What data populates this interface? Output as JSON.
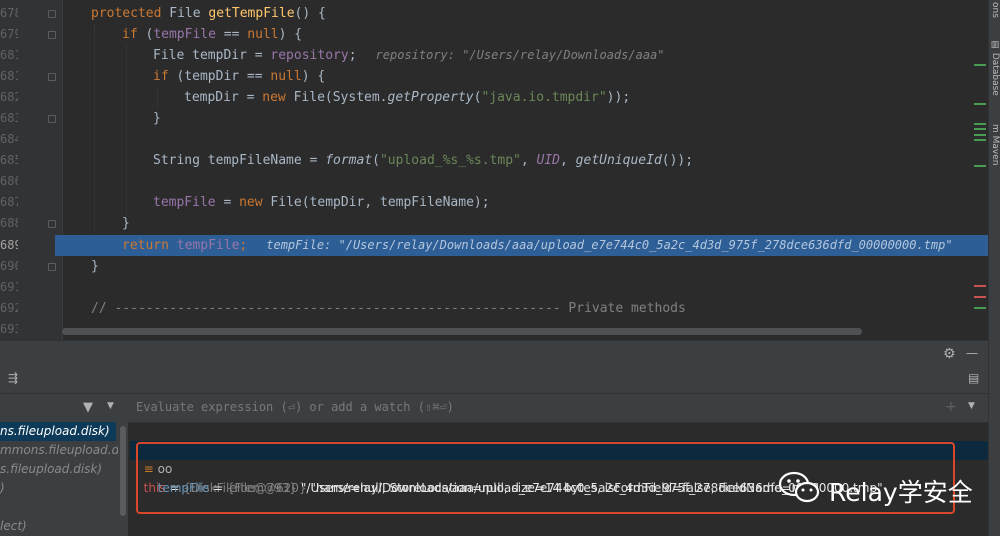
{
  "editor": {
    "lines": [
      {
        "num": "678"
      },
      {
        "num": "679"
      },
      {
        "num": "681"
      },
      {
        "num": "681"
      },
      {
        "num": "682"
      },
      {
        "num": "683"
      },
      {
        "num": "684"
      },
      {
        "num": "685"
      },
      {
        "num": "686"
      },
      {
        "num": "687"
      },
      {
        "num": "688"
      },
      {
        "num": "689"
      },
      {
        "num": "690"
      },
      {
        "num": "691"
      },
      {
        "num": "692"
      },
      {
        "num": "693"
      }
    ],
    "code": {
      "l1_kw": "protected",
      "l1_type": " File ",
      "l1_fn": "getTempFile",
      "l1_rest": "() {",
      "l2_kw": "if",
      "l2_a": " (",
      "l2_fld": "tempFile",
      "l2_b": " == ",
      "l2_kw2": "null",
      "l2_c": ") {",
      "l3_a": "File tempDir = ",
      "l3_fld": "repository",
      "l3_b": ";",
      "l3_hint": "repository: \"/Users/relay/Downloads/aaa\"",
      "l4_kw": "if",
      "l4_a": " (tempDir == ",
      "l4_kw2": "null",
      "l4_b": ") {",
      "l5_a": "tempDir = ",
      "l5_kw": "new",
      "l5_b": " File(System.",
      "l5_fn": "getProperty",
      "l5_c": "(",
      "l5_str": "\"java.io.tmpdir\"",
      "l5_d": "));",
      "l6": "}",
      "l8_a": "String tempFileName = ",
      "l8_fn": "format",
      "l8_b": "(",
      "l8_str": "\"upload_%s_%s.tmp\"",
      "l8_c": ", ",
      "l8_fld": "UID",
      "l8_d": ", ",
      "l8_fn2": "getUniqueId",
      "l8_e": "());",
      "l10_fld": "tempFile",
      "l10_a": " = ",
      "l10_kw": "new",
      "l10_b": " File(tempDir, tempFileName);",
      "l11": "}",
      "l12_kw": "return",
      "l12_fld": " tempFile",
      "l12_a": ";",
      "l12_hint": "tempFile: \"/Users/relay/Downloads/aaa/upload_e7e744c0_5a2c_4d3d_975f_278dce636dfd_00000000.tmp\"",
      "l13": "}",
      "l15": "// --------------------------------------------------------- Private methods"
    }
  },
  "right_strip": {
    "tabs": [
      "ons",
      "Database",
      "Maven"
    ]
  },
  "debug": {
    "eval_placeholder": "Evaluate expression (⏎) or add a watch (⇧⌘⏎)",
    "frames": [
      {
        "label": "ns.fileupload.disk)"
      },
      {
        "label": "mmons.fileupload.di"
      },
      {
        "label": "s.fileupload.disk)"
      },
      {
        "label": ")"
      },
      {
        "label": ""
      },
      {
        "label": "lect)"
      }
    ],
    "variables": [
      {
        "expander": ">",
        "name": "this",
        "eq": " = ",
        "type": "{DiskFileItem@620}",
        "value": " \"name=null, StoreLocation=null, size=14 bytes, isFormField=false, FieldName=null\""
      },
      {
        "expander": "oo",
        "name": "tempFile",
        "eq": " = ",
        "type": "{File@793}",
        "value": " \"/Users/relay/Downloads/aaa/upload_e7e744c0_5a2c_4d3d_975f_278dce636dfd_00000000.tmp\""
      }
    ]
  },
  "watermark": {
    "text": "Relay学安全",
    "icon": "wechat-icon"
  },
  "colors": {
    "highlight_row": "#2d5e96",
    "annotation_box": "#d9472b"
  }
}
